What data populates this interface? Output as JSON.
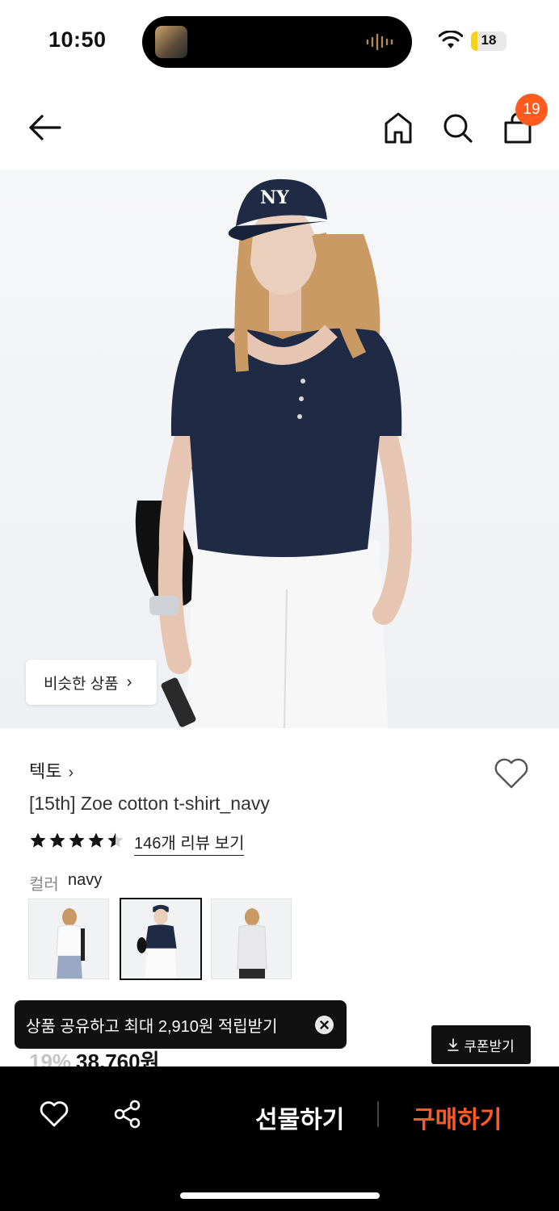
{
  "status_bar": {
    "time": "10:50",
    "battery": "18",
    "battery_level_pct": 18
  },
  "header": {
    "cart_count": "19"
  },
  "hero": {
    "similar_label": "비슷한 상품"
  },
  "product": {
    "brand": "텍토",
    "title": "[15th] Zoe cotton t-shirt_navy",
    "rating_stars": 4.5,
    "review_link": "146개 리뷰 보기",
    "color_label": "컬러",
    "color_value": "navy"
  },
  "toast": {
    "text": "상품 공유하고 최대 2,910원 적립받기"
  },
  "price": {
    "discount": "19%",
    "amount": "38,760원"
  },
  "coupon": {
    "label": "쿠폰받기"
  },
  "bottom_bar": {
    "gift_label": "선물하기",
    "buy_label": "구매하기"
  },
  "colors": {
    "accent": "#ff5a1f",
    "navy": "#1f2a44"
  }
}
